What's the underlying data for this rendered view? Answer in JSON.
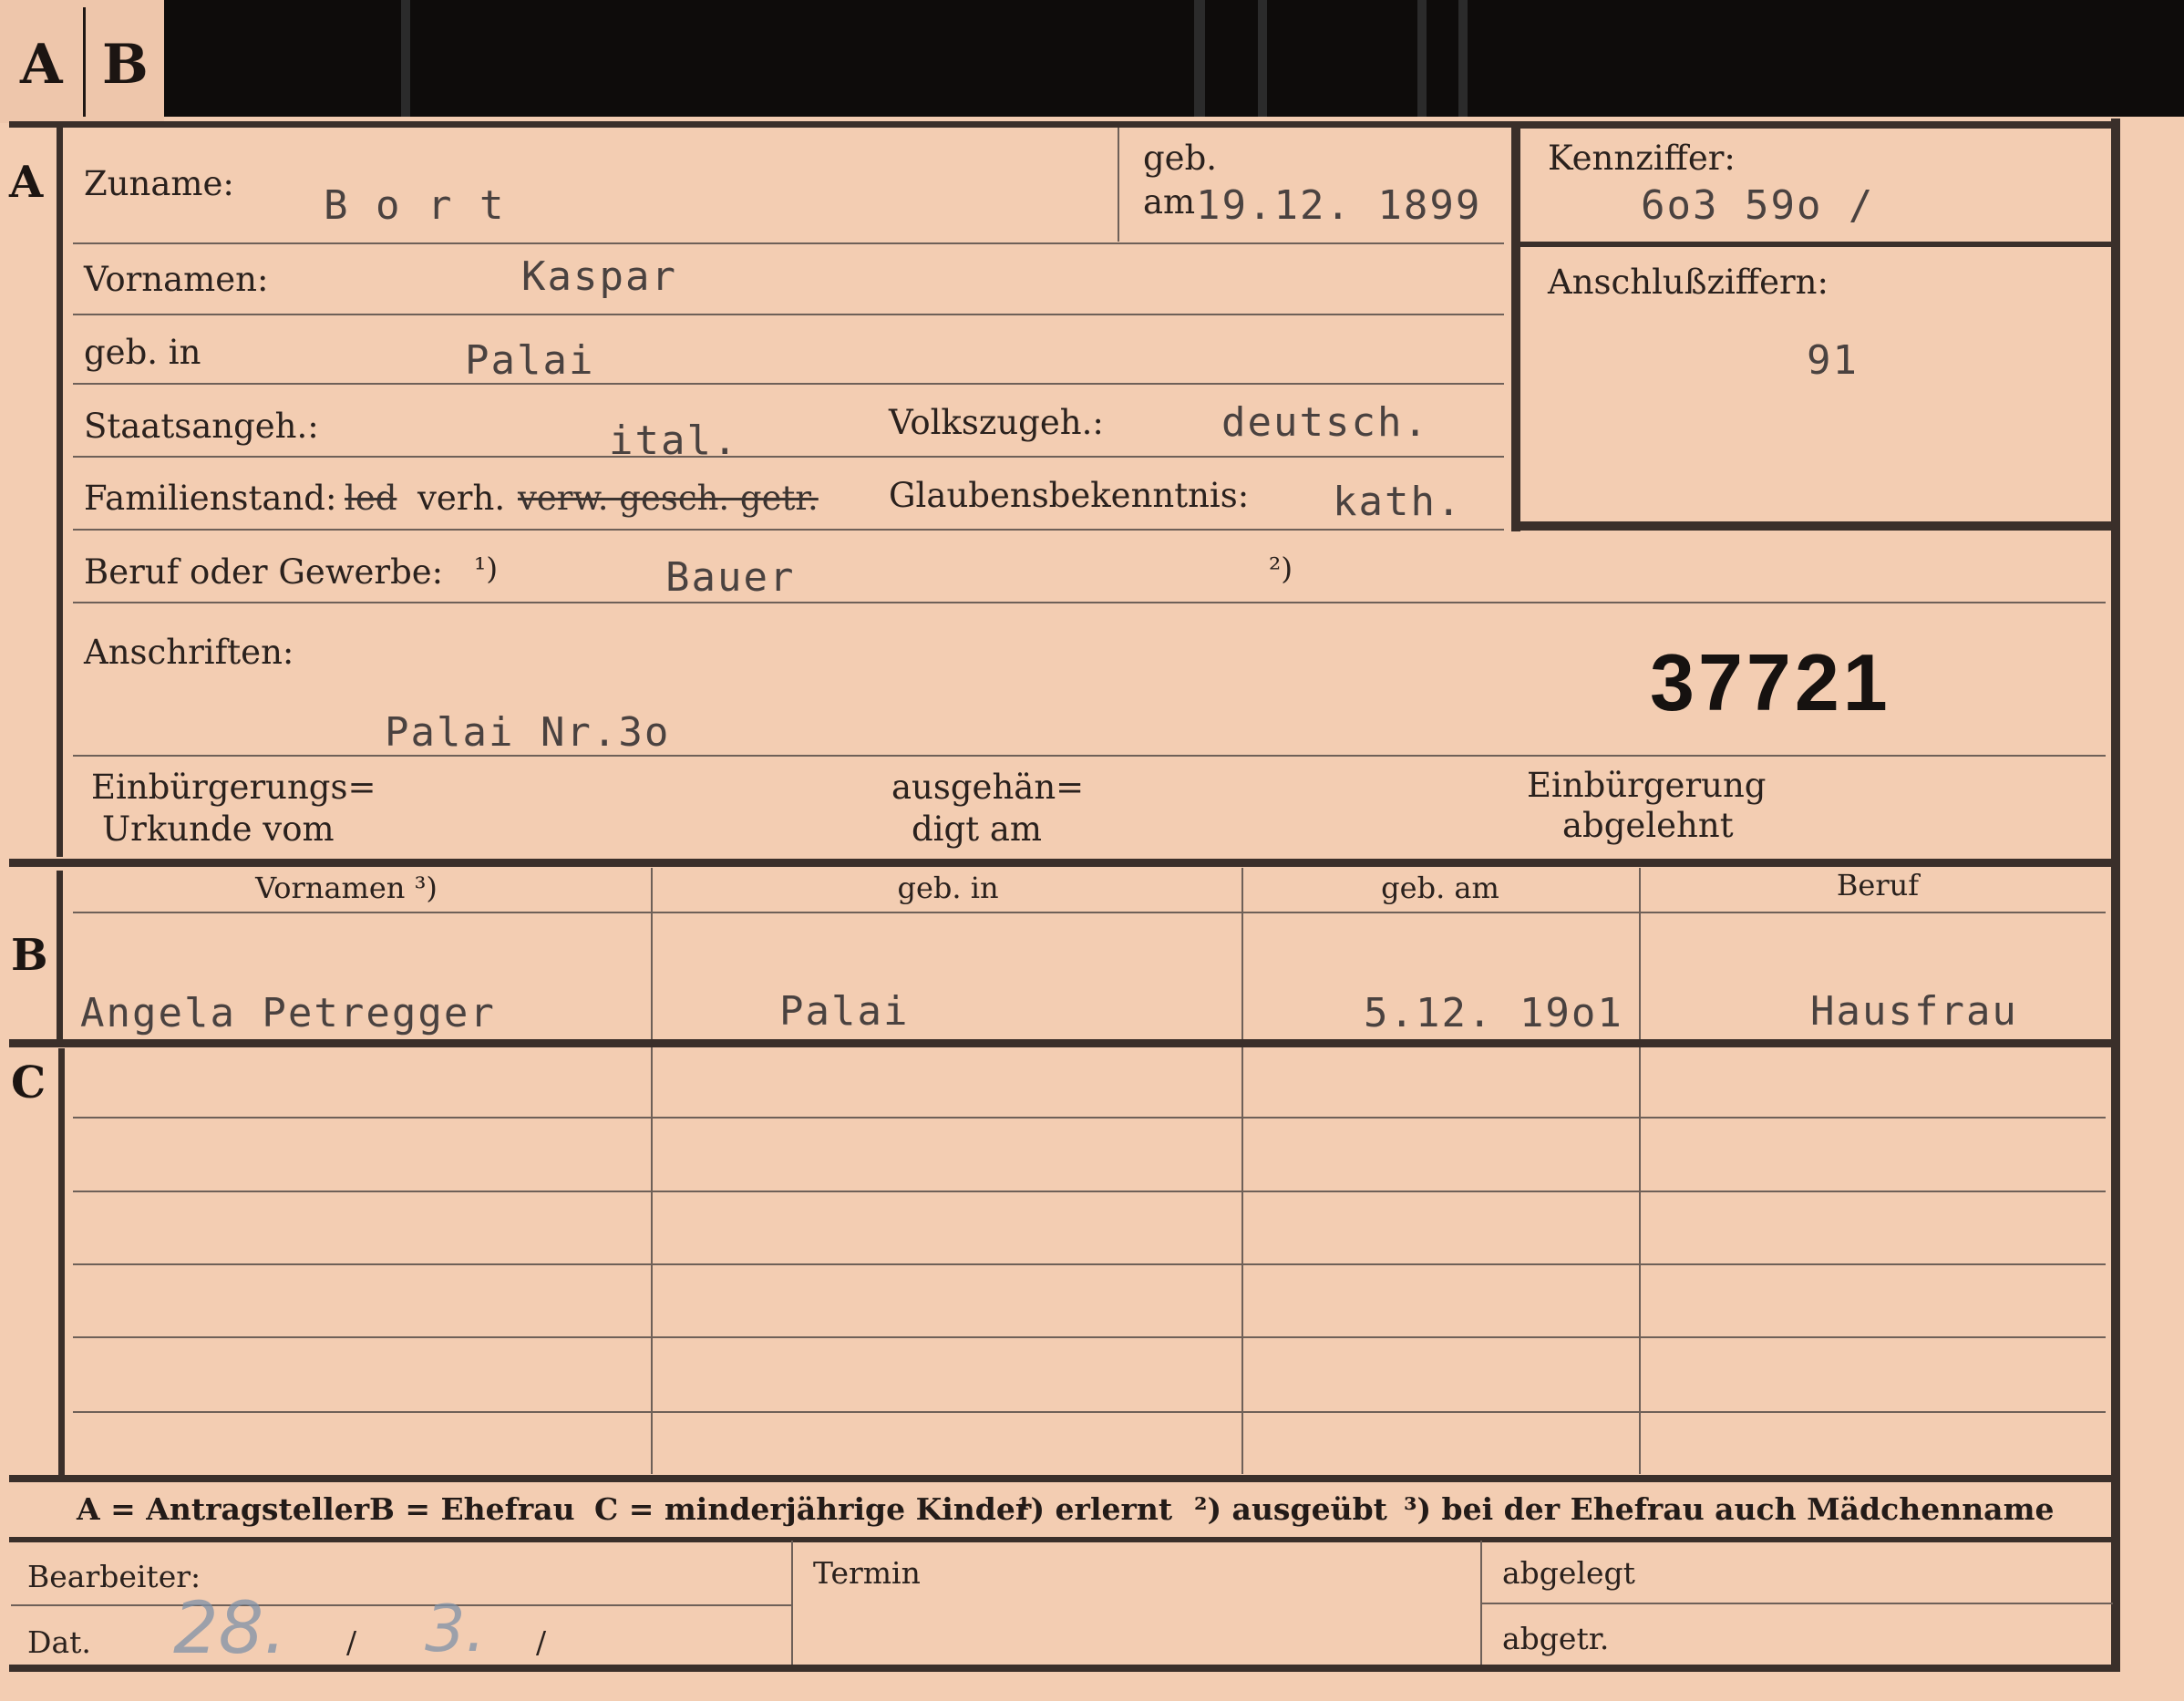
{
  "tab": {
    "a": "A",
    "b": "B"
  },
  "sections": {
    "a": "A",
    "b": "B",
    "c": "C"
  },
  "labels": {
    "zuname": "Zuname:",
    "geb_am_1": "geb.",
    "geb_am_2": "am",
    "kennziffer": "Kennziffer:",
    "vornamen": "Vornamen:",
    "anschlussziffern": "Anschlußziffern:",
    "geb_in": "geb. in",
    "staatsangeh": "Staatsangeh.:",
    "volkszugeh": "Volkszugeh.:",
    "familienstand": "Familienstand:",
    "fam_led": "led",
    "fam_verh": "verh.",
    "fam_rest": "verw. gesch. getr.",
    "glaubensbekenntnis": "Glaubensbekenntnis:",
    "beruf": "Beruf oder Gewerbe:",
    "fn1": "¹)",
    "fn2": "²)",
    "anschriften": "Anschriften:",
    "einb_urkunde_1": "Einbürgerungs=",
    "einb_urkunde_2": "Urkunde vom",
    "ausgehaendigt_1": "ausgehän=",
    "ausgehaendigt_2": "digt am",
    "einb_abgelehnt_1": "Einbürgerung",
    "einb_abgelehnt_2": "abgelehnt"
  },
  "values": {
    "zuname": "B o r t",
    "geb_am": "19.12. 1899",
    "kennziffer": "6o3 59o /",
    "vornamen": "Kaspar",
    "anschlussziffern": "91",
    "geb_in": "Palai",
    "staatsangeh": "ital.",
    "volkszugeh": "deutsch.",
    "glaubensbekenntnis": "kath.",
    "beruf": "Bauer",
    "anschrift": "Palai Nr.3o",
    "nummer": "37721"
  },
  "table": {
    "headers": [
      "Vornamen ³)",
      "geb. in",
      "geb. am",
      "Beruf"
    ],
    "b_row": [
      "Angela Petregger",
      "Palai",
      "5.12. 19o1",
      "Hausfrau"
    ]
  },
  "legend": {
    "a": "A = Antragsteller",
    "b": "B = Ehefrau",
    "c": "C = minderjährige Kinder",
    "n1": "¹) erlernt",
    "n2": "²) ausgeübt",
    "n3": "³) bei der Ehefrau auch Mädchenname"
  },
  "bottom": {
    "bearbeiter": "Bearbeiter:",
    "dat": "Dat.",
    "dat_value_day": "28.",
    "dat_sep1": "/",
    "dat_value_month": "3.",
    "dat_sep2": "/",
    "termin": "Termin",
    "abgelegt": "abgelegt",
    "abgetr": "abgetr."
  }
}
